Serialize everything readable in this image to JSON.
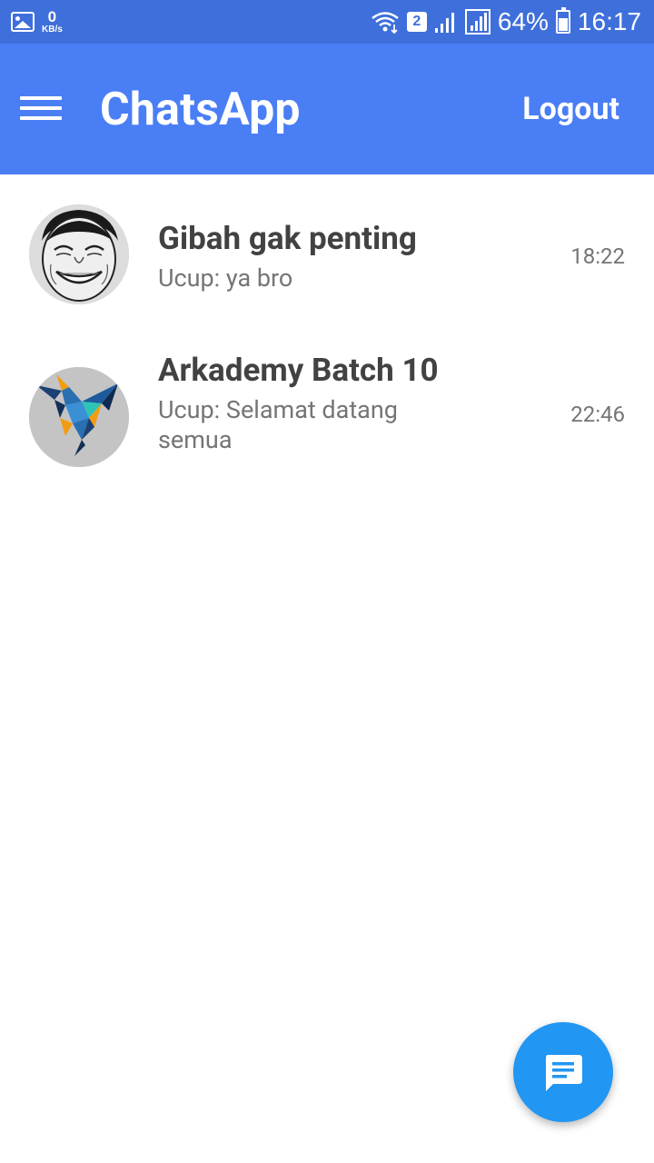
{
  "status_bar": {
    "net_speed_value": "0",
    "net_speed_unit": "KB/s",
    "sim_slot": "2",
    "battery": "64%",
    "time": "16:17",
    "icons": [
      "gallery-icon",
      "wifi-icon",
      "signal-icon",
      "battery-icon"
    ]
  },
  "app_bar": {
    "title": "ChatsApp",
    "logout_label": "Logout",
    "background_color": "#4a7ef5"
  },
  "chats": [
    {
      "name": "Gibah gak penting",
      "preview": "Ucup: ya bro",
      "time": "18:22",
      "avatar": "meme-face-avatar"
    },
    {
      "name": "Arkademy Batch 10",
      "preview": "Ucup: Selamat datang semua",
      "time": "22:46",
      "avatar": "arkademy-bird-logo"
    }
  ],
  "fab": {
    "icon": "new-chat-icon",
    "color": "#2196f3"
  }
}
